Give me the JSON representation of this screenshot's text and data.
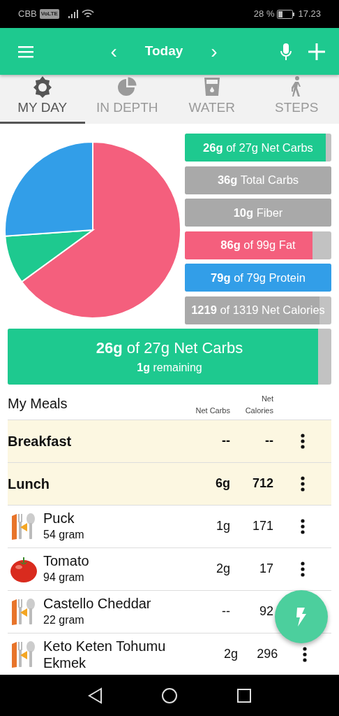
{
  "status_bar": {
    "carrier": "CBB",
    "network_badge": "VoLTE",
    "battery": "28 %",
    "time": "17.23"
  },
  "app_bar": {
    "title": "Today",
    "prev": "‹",
    "next": "›"
  },
  "tabs": [
    {
      "label": "MY DAY",
      "kind": "sun",
      "selected": true
    },
    {
      "label": "IN DEPTH",
      "kind": "pie",
      "selected": false
    },
    {
      "label": "WATER",
      "kind": "glass",
      "selected": false
    },
    {
      "label": "STEPS",
      "kind": "walker",
      "selected": false
    }
  ],
  "macros": [
    {
      "text": "**26g** of 27g Net Carbs",
      "color": "#1ec98f",
      "level": 0.96
    },
    {
      "text": "**36g** Total Carbs",
      "color": "#a9a9a9",
      "level": 1
    },
    {
      "text": "**10g** Fiber",
      "color": "#a9a9a9",
      "level": 1
    },
    {
      "text": "**86g** of 99g Fat",
      "color": "#f45f7d",
      "level": 0.87
    },
    {
      "text": "**79g** of 79g Protein",
      "color": "#329ee8",
      "level": 1
    },
    {
      "text": "**1219** of 1319 Net Calories",
      "color": "#a9a9a9",
      "level": 0.92
    }
  ],
  "goal": {
    "text": "**26g** of 27g Net Carbs",
    "subtext": "**1g** remaining",
    "color": "#1ec98f",
    "level": 0.96
  },
  "meals": {
    "title": "My Meals",
    "columns": [
      "Net Carbs",
      "Net Calories"
    ],
    "rows": [
      {
        "kind": "meal",
        "name": "Breakfast",
        "net_carbs": "--",
        "net_calories": "--",
        "menu": true
      },
      {
        "kind": "meal",
        "name": "Lunch",
        "net_carbs": "6g",
        "net_calories": "712",
        "menu": true
      },
      {
        "kind": "custom-food",
        "name": "Puck",
        "amount": "54 gram",
        "net_carbs": "1g",
        "net_calories": "171",
        "menu": true
      },
      {
        "kind": "food",
        "name": "Tomato",
        "amount": "94 gram",
        "net_carbs": "2g",
        "net_calories": "17",
        "menu": true
      },
      {
        "kind": "custom-food",
        "name": "Castello Cheddar",
        "amount": "22 gram",
        "net_carbs": "--",
        "net_calories": "92",
        "menu": false
      },
      {
        "kind": "custom-food",
        "name": "Keto Keten Tohumu Ekmek",
        "net_carbs": "2g",
        "net_calories": "296",
        "menu": true
      }
    ]
  }
}
